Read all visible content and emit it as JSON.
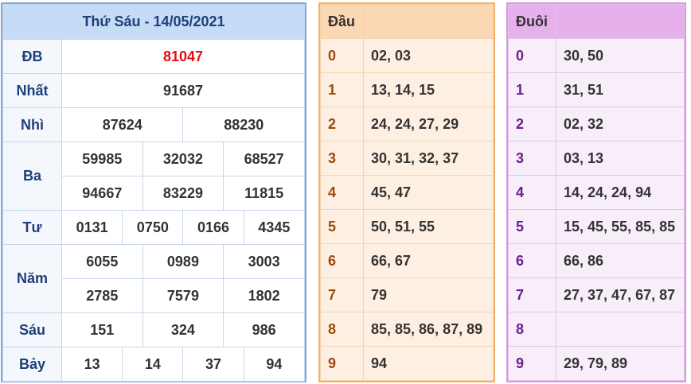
{
  "results": {
    "title": "Thứ Sáu - 14/05/2021",
    "db": {
      "label": "ĐB",
      "value": "81047"
    },
    "nhat": {
      "label": "Nhất",
      "value": "91687"
    },
    "nhi": {
      "label": "Nhì",
      "values": [
        "87624",
        "88230"
      ]
    },
    "ba": {
      "label": "Ba",
      "values": [
        "59985",
        "32032",
        "68527",
        "94667",
        "83229",
        "11815"
      ]
    },
    "tu": {
      "label": "Tư",
      "values": [
        "0131",
        "0750",
        "0166",
        "4345"
      ]
    },
    "nam": {
      "label": "Năm",
      "values": [
        "6055",
        "0989",
        "3003",
        "2785",
        "7579",
        "1802"
      ]
    },
    "sau": {
      "label": "Sáu",
      "values": [
        "151",
        "324",
        "986"
      ]
    },
    "bay": {
      "label": "Bảy",
      "values": [
        "13",
        "14",
        "37",
        "94"
      ]
    }
  },
  "dau": {
    "header": "Đầu",
    "rows": [
      {
        "k": "0",
        "v": "02, 03"
      },
      {
        "k": "1",
        "v": "13, 14, 15"
      },
      {
        "k": "2",
        "v": "24, 24, 27, 29"
      },
      {
        "k": "3",
        "v": "30, 31, 32, 37"
      },
      {
        "k": "4",
        "v": "45, 47"
      },
      {
        "k": "5",
        "v": "50, 51, 55"
      },
      {
        "k": "6",
        "v": "66, 67"
      },
      {
        "k": "7",
        "v": "79"
      },
      {
        "k": "8",
        "v": "85, 85, 86, 87, 89"
      },
      {
        "k": "9",
        "v": "94"
      }
    ]
  },
  "duoi": {
    "header": "Đuôi",
    "rows": [
      {
        "k": "0",
        "v": "30, 50"
      },
      {
        "k": "1",
        "v": "31, 51"
      },
      {
        "k": "2",
        "v": "02, 32"
      },
      {
        "k": "3",
        "v": "03, 13"
      },
      {
        "k": "4",
        "v": "14, 24, 24, 94"
      },
      {
        "k": "5",
        "v": "15, 45, 55, 85, 85"
      },
      {
        "k": "6",
        "v": "66, 86"
      },
      {
        "k": "7",
        "v": "27, 37, 47, 67, 87"
      },
      {
        "k": "8",
        "v": ""
      },
      {
        "k": "9",
        "v": "29, 79, 89"
      }
    ]
  }
}
